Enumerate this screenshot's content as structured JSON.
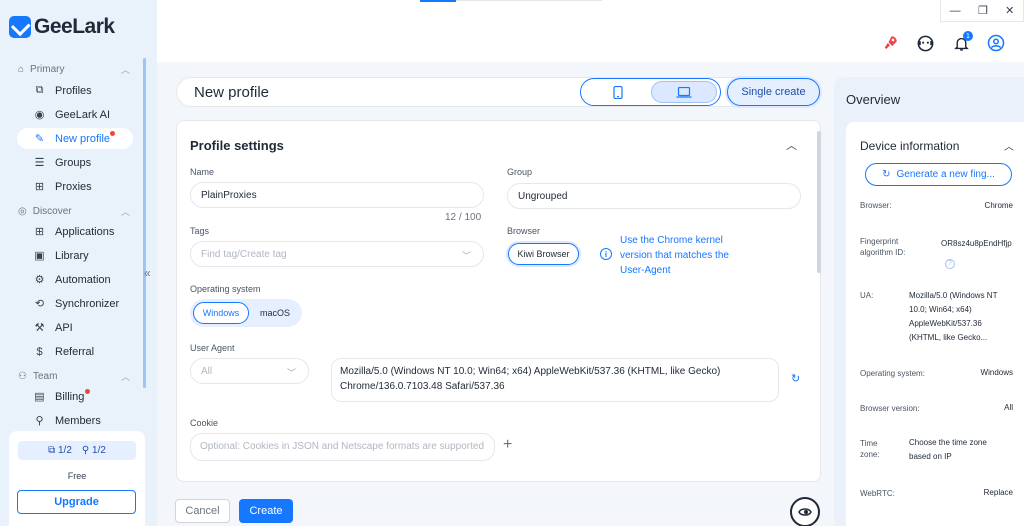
{
  "app": {
    "name": "GeeLark"
  },
  "sidebar": {
    "sections": [
      {
        "label": "Primary"
      },
      {
        "label": "Discover"
      },
      {
        "label": "Team"
      }
    ],
    "items": [
      {
        "label": "Profiles"
      },
      {
        "label": "GeeLark AI"
      },
      {
        "label": "New profile"
      },
      {
        "label": "Groups"
      },
      {
        "label": "Proxies"
      },
      {
        "label": "Applications"
      },
      {
        "label": "Library"
      },
      {
        "label": "Automation"
      },
      {
        "label": "Synchronizer"
      },
      {
        "label": "API"
      },
      {
        "label": "Referral"
      },
      {
        "label": "Billing"
      },
      {
        "label": "Members"
      }
    ],
    "plan": {
      "phone_count": "1/2",
      "member_count": "1/2",
      "name": "Free",
      "upgrade_label": "Upgrade"
    }
  },
  "topbar": {
    "notification_count": "1"
  },
  "main": {
    "title": "New profile",
    "single_create_label": "Single create",
    "settings_title": "Profile settings",
    "name": {
      "label": "Name",
      "value": "PlainProxies",
      "counter": "12 / 100"
    },
    "group": {
      "label": "Group",
      "value": "Ungrouped"
    },
    "tags": {
      "label": "Tags",
      "placeholder": "Find tag/Create tag"
    },
    "browser": {
      "label": "Browser",
      "selected": "Kiwi Browser",
      "hint": "Use the Chrome kernel version that matches the User-Agent"
    },
    "os": {
      "label": "Operating system",
      "options": [
        "Windows",
        "macOS"
      ],
      "selected": "Windows"
    },
    "user_agent": {
      "label": "User Agent",
      "select_value": "All",
      "value": "Mozilla/5.0 (Windows NT 10.0; Win64; x64) AppleWebKit/537.36 (KHTML, like Gecko) Chrome/136.0.7103.48 Safari/537.36"
    },
    "cookie": {
      "label": "Cookie",
      "placeholder": "Optional: Cookies in JSON and Netscape formats are supported"
    },
    "cancel_label": "Cancel",
    "create_label": "Create"
  },
  "overview": {
    "title": "Overview",
    "device_title": "Device information",
    "generate_label": "Generate a new fing...",
    "rows": [
      {
        "key": "Browser:",
        "value": "Chrome"
      },
      {
        "key": "Fingerprint algorithm ID:",
        "value": "OR8sz4u8pEndHfjp"
      },
      {
        "key": "UA:",
        "value": "Mozilla/5.0 (Windows NT 10.0; Win64; x64) AppleWebKit/537.36 (KHTML, like Gecko..."
      },
      {
        "key": "Operating system:",
        "value": "Windows"
      },
      {
        "key": "Browser version:",
        "value": "All"
      },
      {
        "key": "Time zone:",
        "value": "Choose the time zone based on IP"
      },
      {
        "key": "WebRTC:",
        "value": "Replace"
      }
    ]
  },
  "colors": {
    "accent": "#1677ff",
    "sidebar_bg": "#e9f1fb",
    "alert": "#ef4444"
  }
}
